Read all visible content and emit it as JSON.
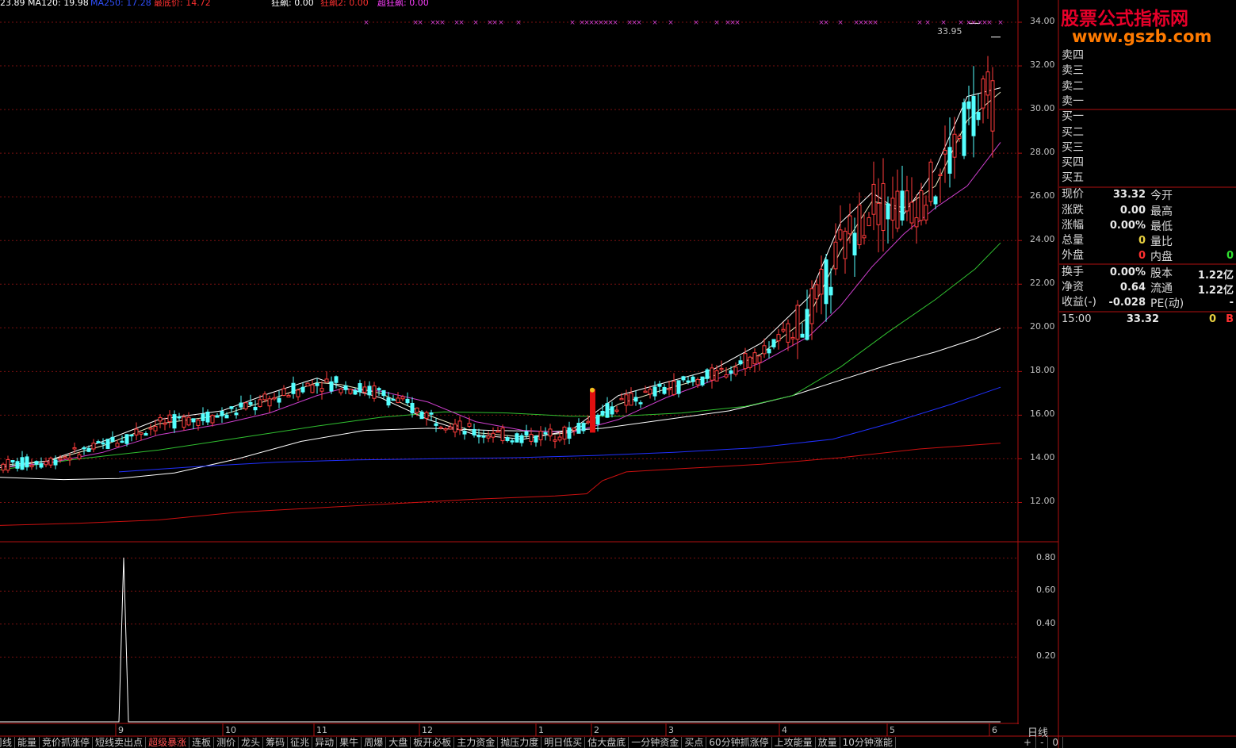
{
  "header": {
    "items": [
      {
        "text": "23.89",
        "color": "#ffffff"
      },
      {
        "text": "MA120: 19.98",
        "color": "#ffffff"
      },
      {
        "text": "MA250: 17.28",
        "color": "#3050ff"
      },
      {
        "text": "最底价: 14.72",
        "color": "#ff3030"
      },
      {
        "text": "狂飙: 0.00",
        "color": "#ffffff"
      },
      {
        "text": "狂飙2: 0.00",
        "color": "#ff3030"
      },
      {
        "text": "超狂飙: 0.00",
        "color": "#ff40ff"
      }
    ]
  },
  "watermark": {
    "line1": "股票公式指标网",
    "line2": "www.gszb.com"
  },
  "price_axis": {
    "ticks": [
      "34.00",
      "32.00",
      "30.00",
      "28.00",
      "26.00",
      "24.00",
      "22.00",
      "20.00",
      "18.00",
      "16.00",
      "14.00",
      "12.00"
    ],
    "high_label": "33.95"
  },
  "indicator_axis": {
    "ticks": [
      "0.80",
      "0.60",
      "0.40",
      "0.20"
    ]
  },
  "date_axis": [
    "9",
    "10",
    "11",
    "12",
    "1",
    "2",
    "3",
    "4",
    "5",
    "6"
  ],
  "quote": {
    "order_book": [
      "卖四",
      "卖三",
      "卖二",
      "卖一",
      "买一",
      "买二",
      "买三",
      "买四",
      "买五"
    ],
    "rows": [
      {
        "label": "现价",
        "value": "33.32",
        "label2": "今开",
        "value2": ""
      },
      {
        "label": "涨跌",
        "value": "0.00",
        "label2": "最高",
        "value2": ""
      },
      {
        "label": "涨幅",
        "value": "0.00%",
        "label2": "最低",
        "value2": ""
      },
      {
        "label": "总量",
        "value": "0",
        "label2": "量比",
        "value2": ""
      },
      {
        "label": "外盘",
        "value": "0",
        "label2": "内盘",
        "value2": "0"
      },
      {
        "label": "换手",
        "value": "0.00%",
        "label2": "股本",
        "value2": "1.22亿"
      },
      {
        "label": "净资",
        "value": "0.64",
        "label2": "流通",
        "value2": "1.22亿"
      },
      {
        "label": "收益(-)",
        "value": "-0.028",
        "label2": "PE(动)",
        "value2": "-"
      }
    ],
    "tick": {
      "time": "15:00",
      "price": "33.32",
      "vol": "0",
      "flag": "B"
    }
  },
  "tabs": [
    "周线",
    "能量",
    "竞价抓涨停",
    "短线卖出点",
    "超级暴涨",
    "连板",
    "测价",
    "龙头",
    "筹码",
    "征兆",
    "异动",
    "果牛",
    "周爆",
    "大盘",
    "板开必板",
    "主力资金",
    "抛压力度",
    "明日低买",
    "估大盘底",
    "一分钟资金",
    "买点",
    "60分钟抓涨停",
    "上攻能量",
    "放量",
    "10分钟涨能"
  ],
  "active_tab": "超级暴涨",
  "period": "日线",
  "zoom_controls": [
    "+",
    "-",
    "0"
  ],
  "chart_data": {
    "type": "candlestick",
    "ylim": [
      10.2,
      34.8
    ],
    "current_price": 33.32,
    "period_high": 33.95,
    "ma_lines": [
      {
        "name": "MA120",
        "color": "#ffffff",
        "points": [
          [
            0,
            13.15
          ],
          [
            80,
            13.05
          ],
          [
            150,
            13.1
          ],
          [
            220,
            13.35
          ],
          [
            300,
            14.0
          ],
          [
            380,
            14.8
          ],
          [
            460,
            15.3
          ],
          [
            540,
            15.4
          ],
          [
            620,
            15.3
          ],
          [
            700,
            15.25
          ],
          [
            760,
            15.4
          ],
          [
            840,
            15.8
          ],
          [
            920,
            16.2
          ],
          [
            1000,
            16.9
          ],
          [
            1060,
            17.6
          ],
          [
            1120,
            18.3
          ],
          [
            1180,
            18.9
          ],
          [
            1230,
            19.5
          ],
          [
            1262,
            19.98
          ]
        ]
      },
      {
        "name": "MA250",
        "color": "#2030ff",
        "points": [
          [
            150,
            13.4
          ],
          [
            250,
            13.65
          ],
          [
            350,
            13.85
          ],
          [
            450,
            13.95
          ],
          [
            550,
            14.0
          ],
          [
            650,
            14.05
          ],
          [
            750,
            14.15
          ],
          [
            850,
            14.3
          ],
          [
            950,
            14.5
          ],
          [
            1050,
            14.9
          ],
          [
            1120,
            15.6
          ],
          [
            1200,
            16.5
          ],
          [
            1262,
            17.28
          ]
        ]
      },
      {
        "name": "最底价",
        "color": "#cc1010",
        "points": [
          [
            0,
            10.95
          ],
          [
            100,
            11.05
          ],
          [
            200,
            11.2
          ],
          [
            300,
            11.55
          ],
          [
            400,
            11.75
          ],
          [
            500,
            11.95
          ],
          [
            600,
            12.15
          ],
          [
            700,
            12.3
          ],
          [
            740,
            12.4
          ],
          [
            760,
            13.0
          ],
          [
            790,
            13.4
          ],
          [
            860,
            13.55
          ],
          [
            960,
            13.75
          ],
          [
            1060,
            14.05
          ],
          [
            1160,
            14.45
          ],
          [
            1262,
            14.72
          ]
        ]
      },
      {
        "name": "green",
        "color": "#30c030",
        "points": [
          [
            0,
            13.5
          ],
          [
            100,
            14.0
          ],
          [
            200,
            14.4
          ],
          [
            300,
            14.95
          ],
          [
            400,
            15.5
          ],
          [
            480,
            15.9
          ],
          [
            560,
            16.15
          ],
          [
            640,
            16.1
          ],
          [
            720,
            15.95
          ],
          [
            780,
            15.95
          ],
          [
            860,
            16.1
          ],
          [
            940,
            16.4
          ],
          [
            1000,
            16.9
          ],
          [
            1060,
            18.2
          ],
          [
            1120,
            19.8
          ],
          [
            1180,
            21.3
          ],
          [
            1230,
            22.7
          ],
          [
            1262,
            23.89
          ]
        ]
      },
      {
        "name": "magenta",
        "color": "#d040d0",
        "points": [
          [
            0,
            13.6
          ],
          [
            60,
            13.8
          ],
          [
            130,
            14.3
          ],
          [
            200,
            15.1
          ],
          [
            280,
            15.6
          ],
          [
            340,
            16.1
          ],
          [
            400,
            16.9
          ],
          [
            430,
            17.2
          ],
          [
            480,
            17.1
          ],
          [
            540,
            16.6
          ],
          [
            600,
            15.7
          ],
          [
            660,
            15.3
          ],
          [
            720,
            15.2
          ],
          [
            780,
            15.8
          ],
          [
            840,
            16.8
          ],
          [
            900,
            17.6
          ],
          [
            960,
            18.4
          ],
          [
            1020,
            19.6
          ],
          [
            1060,
            21.0
          ],
          [
            1100,
            22.8
          ],
          [
            1140,
            24.3
          ],
          [
            1180,
            25.5
          ],
          [
            1220,
            26.5
          ],
          [
            1262,
            28.5
          ]
        ]
      },
      {
        "name": "yellow",
        "color": "#e8e8c0",
        "points": [
          [
            0,
            13.7
          ],
          [
            60,
            13.9
          ],
          [
            130,
            14.6
          ],
          [
            200,
            15.6
          ],
          [
            280,
            16.0
          ],
          [
            340,
            16.7
          ],
          [
            400,
            17.5
          ],
          [
            430,
            17.4
          ],
          [
            480,
            17.0
          ],
          [
            540,
            16.0
          ],
          [
            600,
            15.2
          ],
          [
            660,
            15.0
          ],
          [
            720,
            15.2
          ],
          [
            780,
            16.5
          ],
          [
            840,
            17.2
          ],
          [
            900,
            17.8
          ],
          [
            960,
            18.8
          ],
          [
            1020,
            20.5
          ],
          [
            1060,
            23.5
          ],
          [
            1100,
            25.8
          ],
          [
            1140,
            25.5
          ],
          [
            1180,
            26.5
          ],
          [
            1220,
            29.5
          ],
          [
            1262,
            30.8
          ]
        ]
      },
      {
        "name": "white2",
        "color": "#ffffff",
        "points": [
          [
            0,
            13.6
          ],
          [
            60,
            13.9
          ],
          [
            130,
            14.8
          ],
          [
            200,
            15.8
          ],
          [
            280,
            16.2
          ],
          [
            340,
            17.0
          ],
          [
            400,
            17.7
          ],
          [
            430,
            17.3
          ],
          [
            480,
            16.8
          ],
          [
            540,
            15.8
          ],
          [
            600,
            15.1
          ],
          [
            660,
            14.9
          ],
          [
            720,
            15.3
          ],
          [
            780,
            16.9
          ],
          [
            840,
            17.5
          ],
          [
            900,
            18.1
          ],
          [
            960,
            19.3
          ],
          [
            1020,
            21.4
          ],
          [
            1060,
            24.8
          ],
          [
            1100,
            26.2
          ],
          [
            1140,
            25.2
          ],
          [
            1180,
            27.3
          ],
          [
            1220,
            30.6
          ],
          [
            1262,
            31.0
          ]
        ]
      }
    ],
    "marker_xs": [
      462,
      524,
      530,
      546,
      552,
      558,
      576,
      582,
      600,
      618,
      624,
      632,
      654,
      722,
      734,
      740,
      746,
      752,
      758,
      764,
      770,
      776,
      794,
      800,
      806,
      826,
      846,
      878,
      904,
      918,
      924,
      930,
      1036,
      1042,
      1060,
      1080,
      1086,
      1092,
      1098,
      1104,
      1160,
      1170,
      1190,
      1212,
      1222,
      1228,
      1236,
      1242,
      1248,
      1262
    ]
  }
}
